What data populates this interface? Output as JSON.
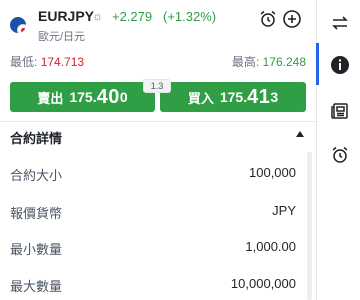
{
  "header": {
    "symbol": "EURJPY",
    "change": "+2.279",
    "change_pct": "(+1.32%)",
    "subtitle": "歐元/日元"
  },
  "range": {
    "low_label": "最低:",
    "low_value": "174.713",
    "high_label": "最高:",
    "high_value": "176.248"
  },
  "spread": "1.3",
  "sell": {
    "label": "賣出",
    "p1": "175.",
    "p2": "40",
    "p3": "0"
  },
  "buy": {
    "label": "買入",
    "p1": "175.",
    "p2": "41",
    "p3": "3"
  },
  "section": {
    "title": "合約詳情"
  },
  "details": [
    {
      "label": "合約大小",
      "value": "100,000"
    },
    {
      "label": "報價貨幣",
      "value": "JPY"
    },
    {
      "label": "最小數量",
      "value": "1,000.00"
    },
    {
      "label": "最大數量",
      "value": "10,000,000"
    }
  ],
  "colors": {
    "up": "#2f9e44",
    "down": "#d1242f",
    "accent": "#2563eb"
  },
  "icons": [
    "sun-icon",
    "alarm-clock-icon",
    "plus-circle-icon",
    "swap-arrows-icon",
    "info-icon",
    "news-icon",
    "alarm-icon"
  ]
}
